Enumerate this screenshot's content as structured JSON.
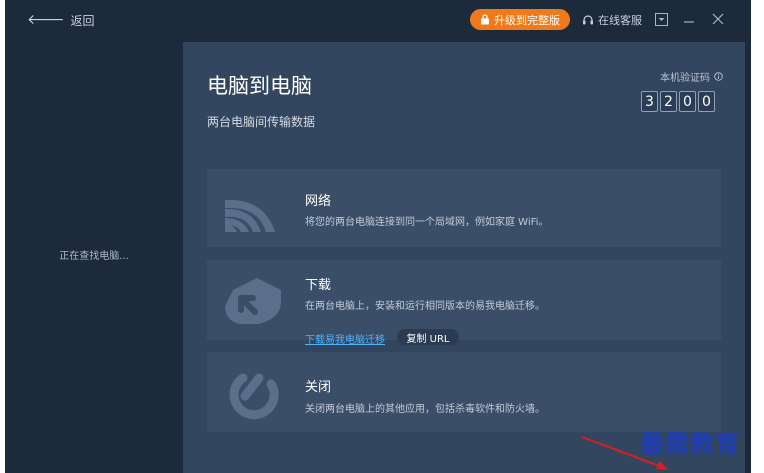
{
  "titlebar": {
    "back_label": "返回",
    "upgrade_label": "升级到完整版",
    "support_label": "在线客服"
  },
  "sidebar": {
    "status_text": "正在查找电脑..."
  },
  "main": {
    "title": "电脑到电脑",
    "subtitle": "两台电脑间传输数据",
    "verification": {
      "label": "本机验证码",
      "digits": [
        "3",
        "2",
        "0",
        "0"
      ]
    },
    "options": [
      {
        "icon": "wifi-icon",
        "title": "网络",
        "description": "将您的两台电脑连接到同一个局域网，例如家庭 WiFi。"
      },
      {
        "icon": "download-icon",
        "title": "下载",
        "description": "在两台电脑上，安装和运行相同版本的易我电脑迁移。",
        "link": "下载易我电脑迁移",
        "copy_button": "复制 URL"
      },
      {
        "icon": "power-icon",
        "title": "关闭",
        "description": "关闭两台电脑上的其他应用，包括杀毒软件和防火墙。"
      }
    ]
  },
  "watermark": "最需教育",
  "colors": {
    "window_bg": "#1c2a3c",
    "panel_bg": "#33465f",
    "card_bg": "#3a4e68",
    "accent": "#f07a1a",
    "link": "#4fb3ff"
  }
}
